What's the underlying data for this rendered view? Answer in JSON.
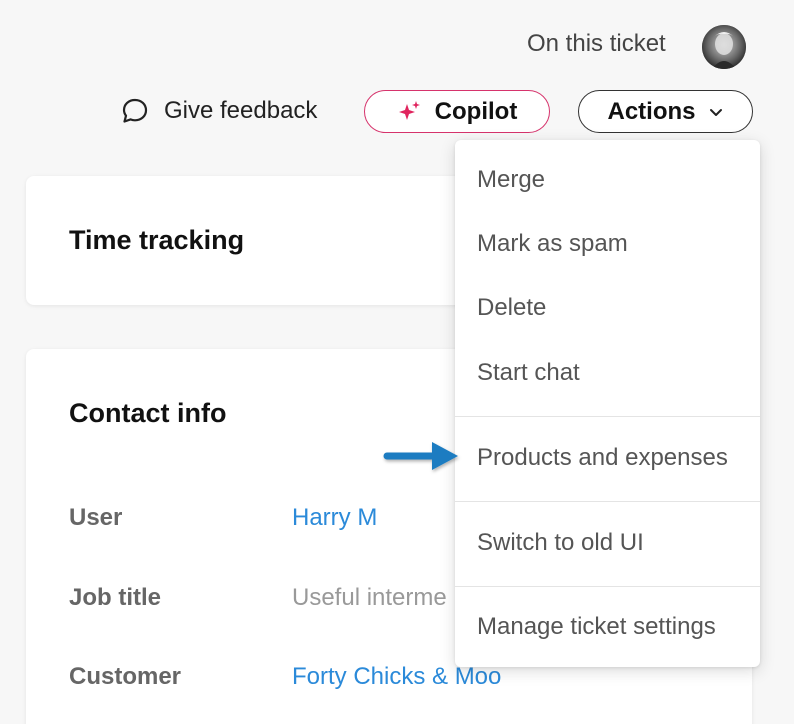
{
  "header": {
    "on_this_ticket": "On this ticket",
    "avatar_icon": "user-avatar"
  },
  "toolbar": {
    "feedback_label": "Give feedback",
    "feedback_icon": "chat-bubble-icon",
    "copilot_label": "Copilot",
    "copilot_icon": "sparkle-icon",
    "copilot_color": "#d6336c",
    "actions_label": "Actions",
    "actions_icon": "chevron-down-icon"
  },
  "cards": {
    "time_tracking": {
      "title": "Time tracking"
    },
    "contact_info": {
      "title": "Contact info",
      "rows": [
        {
          "label": "User",
          "value": "Harry M"
        },
        {
          "label": "Job title",
          "value": "Useful interme"
        },
        {
          "label": "Customer",
          "value": "Forty Chicks & Moo"
        }
      ]
    }
  },
  "actions_menu": {
    "items": [
      {
        "label": "Merge"
      },
      {
        "label": "Mark as spam"
      },
      {
        "label": "Delete"
      },
      {
        "label": "Start chat"
      },
      {
        "label": "Products and expenses"
      },
      {
        "label": "Switch to old UI"
      },
      {
        "label": "Manage ticket settings"
      }
    ]
  },
  "annotation": {
    "arrow_color": "#1a7cc1"
  }
}
